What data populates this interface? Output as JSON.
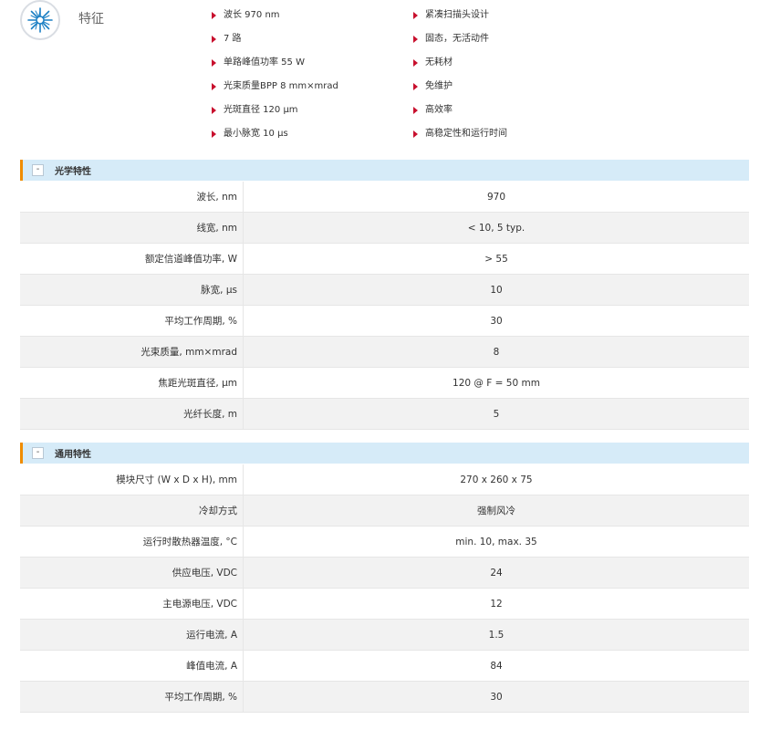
{
  "features": {
    "title": "特征",
    "col1": [
      "波长 970 nm",
      "7 路",
      "单路峰值功率 55 W",
      "光束质量BPP 8 mm×mrad",
      "光斑直径 120 µm",
      "最小脉宽 10 µs"
    ],
    "col2": [
      "紧凑扫描头设计",
      "固态，无活动件",
      "无耗材",
      "免维护",
      "高效率",
      "高稳定性和运行时间"
    ]
  },
  "sections": [
    {
      "toggle": "-",
      "title": "光学特性",
      "rows": [
        {
          "k": "波长, nm",
          "v": "970"
        },
        {
          "k": "线宽, nm",
          "v": "< 10, 5 typ."
        },
        {
          "k": "额定信道峰值功率, W",
          "v": "> 55"
        },
        {
          "k": "脉宽, µs",
          "v": "10"
        },
        {
          "k": "平均工作周期, %",
          "v": "30"
        },
        {
          "k": "光束质量, mm×mrad",
          "v": "8"
        },
        {
          "k": "焦距光斑直径, µm",
          "v": "120 @ F = 50 mm"
        },
        {
          "k": "光纤长度, m",
          "v": "5"
        }
      ]
    },
    {
      "toggle": "-",
      "title": "通用特性",
      "rows": [
        {
          "k": "模块尺寸 (W x D x H), mm",
          "v": "270 x 260 x 75"
        },
        {
          "k": "冷却方式",
          "v": "强制风冷"
        },
        {
          "k": "运行时散热器温度, °C",
          "v": "min. 10, max. 35"
        },
        {
          "k": "供应电压, VDC",
          "v": "24"
        },
        {
          "k": "主电源电压, VDC",
          "v": "12"
        },
        {
          "k": "运行电流, A",
          "v": "1.5"
        },
        {
          "k": "峰值电流, A",
          "v": "84"
        },
        {
          "k": "平均工作周期, %",
          "v": "30"
        }
      ]
    }
  ]
}
